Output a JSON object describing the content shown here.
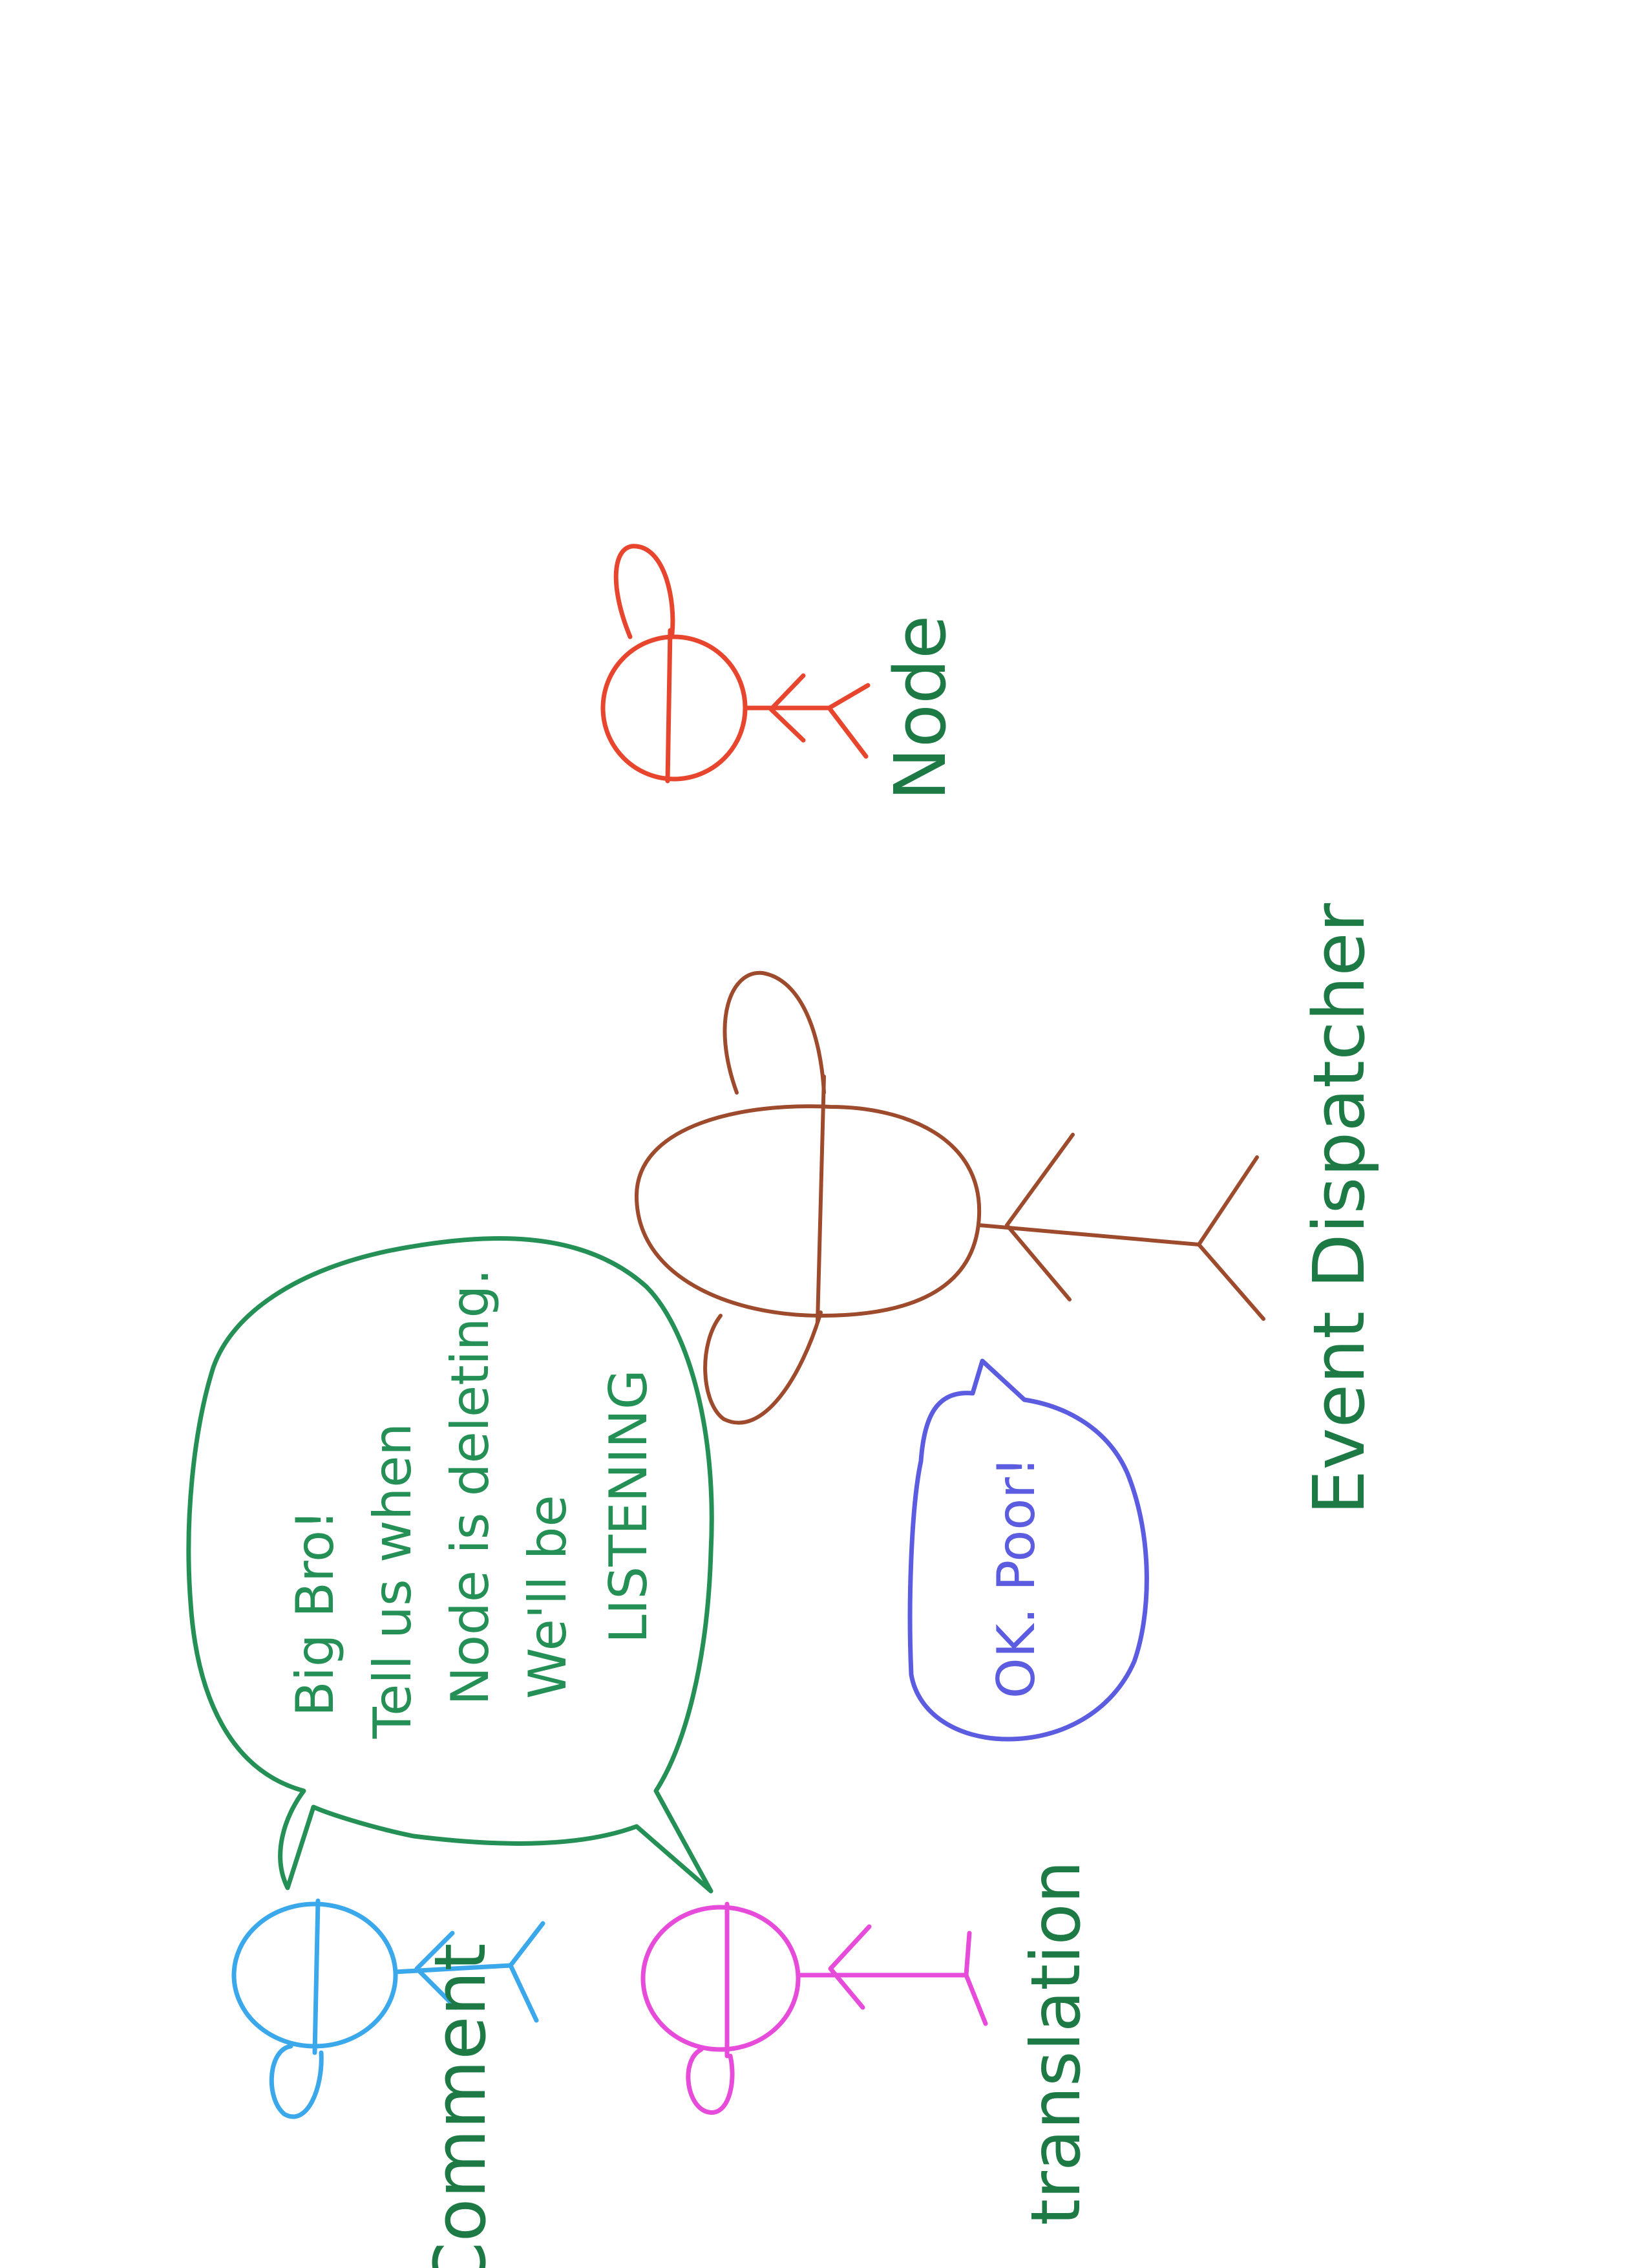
{
  "figures": {
    "node": {
      "label": "Node",
      "color": "#e8452f"
    },
    "dispatcher": {
      "label": "Event Dispatcher",
      "color": "#9e4a2c"
    },
    "comment": {
      "label": "Comment",
      "color": "#3aa8ea"
    },
    "translation": {
      "label": "translation",
      "color": "#e64bd9"
    }
  },
  "label_color": "#1e7a44",
  "bubbles": {
    "listeners": {
      "color": "#249055",
      "lines": [
        "Big Bro!",
        "Tell us when",
        "Node is deleting.",
        "We'll be",
        "LISTENING"
      ]
    },
    "dispatcher_reply": {
      "color": "#5b5ce0",
      "text": "OK. Poor!"
    }
  }
}
